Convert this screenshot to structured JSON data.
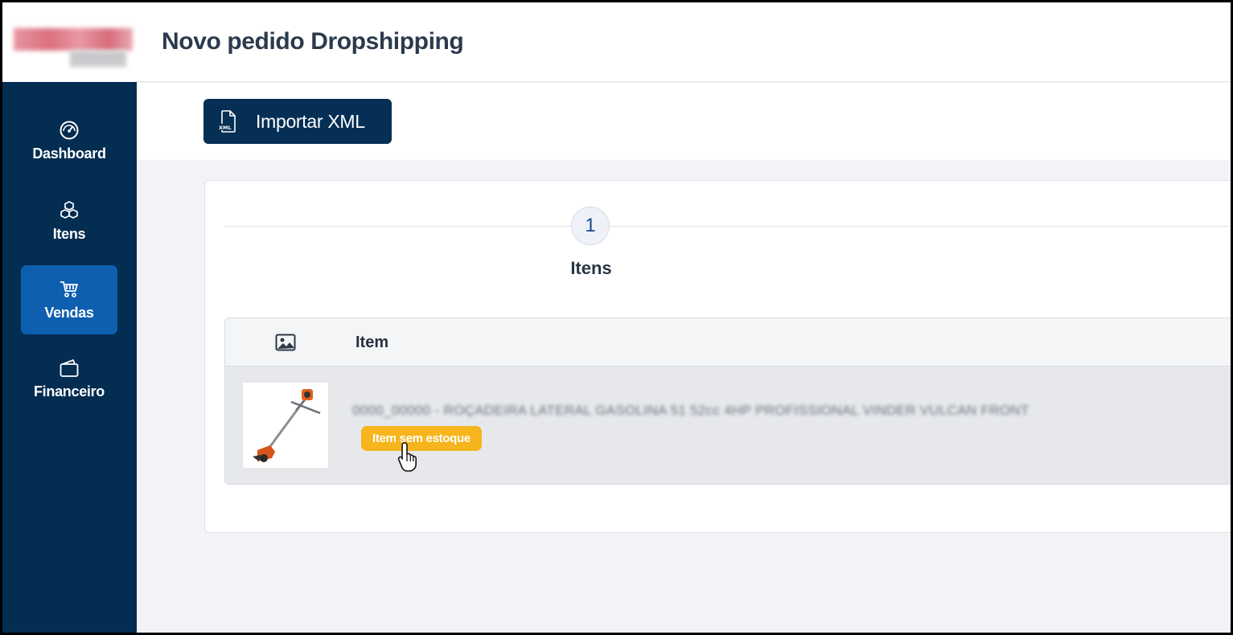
{
  "header": {
    "title": "Novo pedido Dropshipping"
  },
  "sidebar": {
    "items": [
      {
        "label": "Dashboard",
        "icon": "gauge-icon",
        "active": false
      },
      {
        "label": "Itens",
        "icon": "boxes-icon",
        "active": false
      },
      {
        "label": "Vendas",
        "icon": "cart-icon",
        "active": true
      },
      {
        "label": "Financeiro",
        "icon": "wallet-icon",
        "active": false
      }
    ]
  },
  "toolbar": {
    "import_label": "Importar XML",
    "import_icon": "xml-file-icon"
  },
  "stepper": {
    "step_number": "1",
    "step_label": "Itens"
  },
  "table": {
    "columns": [
      {
        "icon": "image-icon"
      },
      {
        "label": "Item"
      }
    ],
    "rows": [
      {
        "name": "0000_00000 - ROÇADEIRA LATERAL GASOLINA 51 52cc 4HP PROFISSIONAL VINDER VULCAN FRONT",
        "badge": "Item sem estoque",
        "thumbnail": "brush-cutter-image"
      }
    ]
  },
  "colors": {
    "sidebar_bg": "#042d52",
    "active_nav": "#0e5fb0",
    "button_bg": "#062f55",
    "badge_bg": "#f6b41d"
  }
}
